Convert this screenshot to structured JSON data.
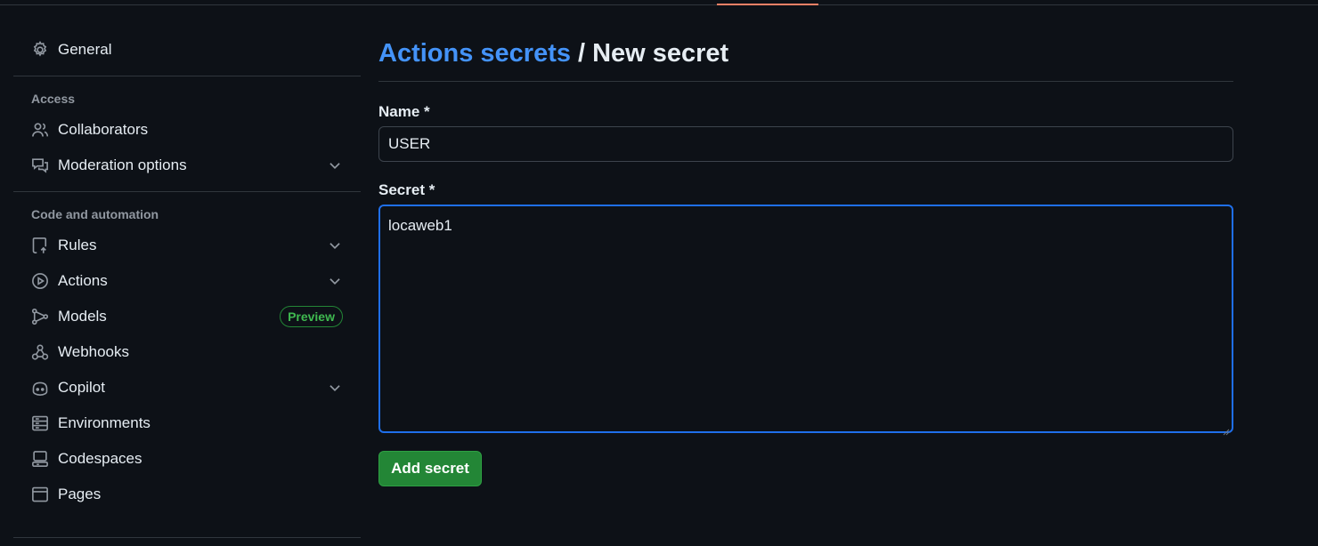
{
  "sidebar": {
    "general": {
      "label": "General",
      "icon": "gear-icon"
    },
    "sections": [
      {
        "heading": "Access",
        "items": [
          {
            "label": "Collaborators",
            "icon": "people-icon",
            "expandable": false
          },
          {
            "label": "Moderation options",
            "icon": "comment-discussion-icon",
            "expandable": true
          }
        ]
      },
      {
        "heading": "Code and automation",
        "items": [
          {
            "label": "Rules",
            "icon": "repo-push-icon",
            "expandable": true
          },
          {
            "label": "Actions",
            "icon": "play-icon",
            "expandable": true
          },
          {
            "label": "Models",
            "icon": "models-icon",
            "expandable": false,
            "badge": "Preview"
          },
          {
            "label": "Webhooks",
            "icon": "webhook-icon",
            "expandable": false
          },
          {
            "label": "Copilot",
            "icon": "copilot-icon",
            "expandable": true
          },
          {
            "label": "Environments",
            "icon": "server-icon",
            "expandable": false
          },
          {
            "label": "Codespaces",
            "icon": "codespaces-icon",
            "expandable": false
          },
          {
            "label": "Pages",
            "icon": "browser-icon",
            "expandable": false
          }
        ]
      }
    ]
  },
  "header": {
    "breadcrumb_link": "Actions secrets",
    "separator": "/",
    "current": "New secret"
  },
  "form": {
    "name_label": "Name *",
    "name_value": "USER",
    "secret_label": "Secret *",
    "secret_value": "locaweb1",
    "submit_label": "Add secret"
  },
  "colors": {
    "background": "#0d1117",
    "link": "#4493f8",
    "primary_button": "#238636",
    "badge_green": "#3fb950",
    "focus_border": "#1f6feb"
  }
}
